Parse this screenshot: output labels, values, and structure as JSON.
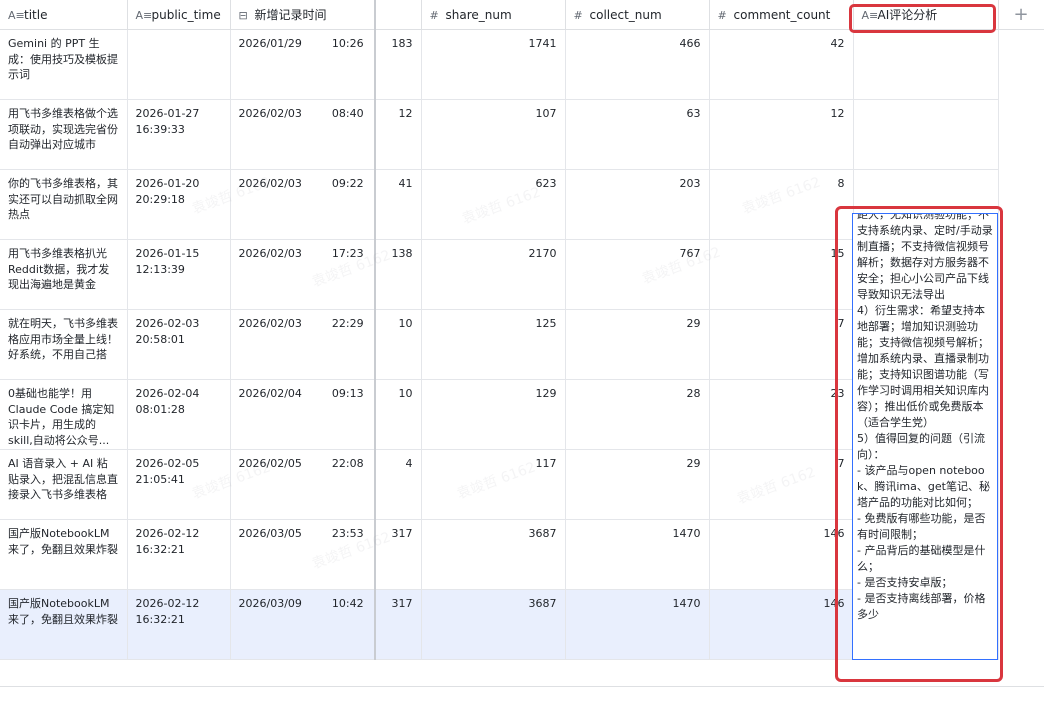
{
  "columns": [
    {
      "label": "title",
      "icon": "A≡"
    },
    {
      "label": "public_time",
      "icon": "A≡"
    },
    {
      "label": "新增记录时间",
      "icon": "⊟"
    },
    {
      "label": "",
      "icon": ""
    },
    {
      "label": "share_num",
      "icon": "#"
    },
    {
      "label": "collect_num",
      "icon": "#"
    },
    {
      "label": "comment_count",
      "icon": "#"
    },
    {
      "label": "AI评论分析",
      "icon": "A≡"
    }
  ],
  "add_column_icon": "+",
  "rows": [
    {
      "title": "Gemini 的 PPT 生成：使用技巧及模板提示词",
      "public_time": "",
      "record_date": "2026/01/29",
      "record_time": "10:26",
      "n1": "183",
      "share_num": "1741",
      "collect_num": "466",
      "comment_count": "42"
    },
    {
      "title": "用飞书多维表格做个选项联动，实现选完省份自动弹出对应城市",
      "public_time": "2026-01-27 16:39:33",
      "record_date": "2026/02/03",
      "record_time": "08:40",
      "n1": "12",
      "share_num": "107",
      "collect_num": "63",
      "comment_count": "12"
    },
    {
      "title": "你的飞书多维表格，其实还可以自动抓取全网热点",
      "public_time": "2026-01-20 20:29:18",
      "record_date": "2026/02/03",
      "record_time": "09:22",
      "n1": "41",
      "share_num": "623",
      "collect_num": "203",
      "comment_count": "8"
    },
    {
      "title": "用飞书多维表格扒光Reddit数据，我才发现出海遍地是黄金",
      "public_time": "2026-01-15 12:13:39",
      "record_date": "2026/02/03",
      "record_time": "17:23",
      "n1": "138",
      "share_num": "2170",
      "collect_num": "767",
      "comment_count": "15"
    },
    {
      "title": "就在明天，飞书多维表格应用市场全量上线！好系统，不用自己搭",
      "public_time": "2026-02-03 20:58:01",
      "record_date": "2026/02/03",
      "record_time": "22:29",
      "n1": "10",
      "share_num": "125",
      "collect_num": "29",
      "comment_count": "7"
    },
    {
      "title": "0基础也能学！用Claude Code 搞定知识卡片，用生成的skill,自动将公众号...",
      "public_time": "2026-02-04 08:01:28",
      "record_date": "2026/02/04",
      "record_time": "09:13",
      "n1": "10",
      "share_num": "129",
      "collect_num": "28",
      "comment_count": "23"
    },
    {
      "title": "AI 语音录入 + AI 粘贴录入，把混乱信息直接录入飞书多维表格",
      "public_time": "2026-02-05 21:05:41",
      "record_date": "2026/02/05",
      "record_time": "22:08",
      "n1": "4",
      "share_num": "117",
      "collect_num": "29",
      "comment_count": "7"
    },
    {
      "title": "国产版NotebookLM来了，免翻且效果炸裂",
      "public_time": "2026-02-12 16:32:21",
      "record_date": "2026/03/05",
      "record_time": "23:53",
      "n1": "317",
      "share_num": "3687",
      "collect_num": "1470",
      "comment_count": "146"
    },
    {
      "title": "国产版NotebookLM来了，免翻且效果炸裂",
      "public_time": "2026-02-12 16:32:21",
      "record_date": "2026/03/09",
      "record_time": "10:42",
      "n1": "317",
      "share_num": "3687",
      "collect_num": "1470",
      "comment_count": "146"
    }
  ],
  "ai_popup_text": "距大，无知识测验功能；不支持系统内录、定时/手动录制直播；不支持微信视频号解析；数据存对方服务器不安全；担心小公司产品下线导致知识无法导出\n4）衍生需求：希望支持本地部署；增加知识测验功能；支持微信视频号解析；增加系统内录、直播录制功能；支持知识图谱功能（写作学习时调用相关知识库内容）；推出低价或免费版本（适合学生党）\n5）值得回复的问题（引流向）：\n- 该产品与open notebook、腾讯ima、get笔记、秘塔产品的功能对比如何；\n- 免费版有哪些功能，是否有时间限制；\n- 产品背后的基础模型是什么；\n- 是否支持安卓版；\n- 是否支持离线部署，价格多少",
  "watermark": "袁竣哲 6162"
}
